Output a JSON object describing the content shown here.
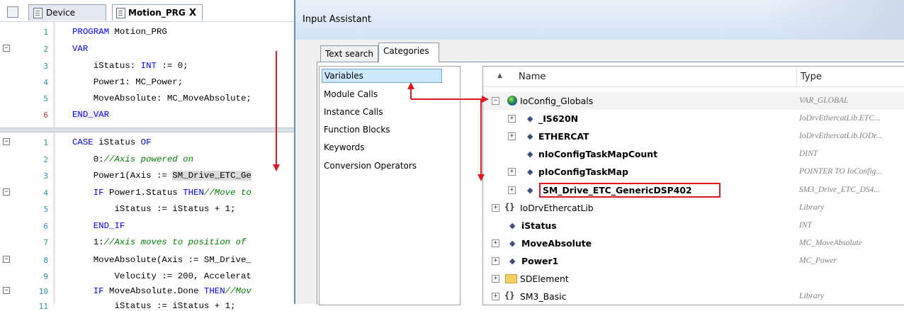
{
  "editor": {
    "tabs": [
      {
        "label": "Device"
      },
      {
        "label": "Motion_PRG",
        "close": "X"
      }
    ],
    "decl_lines": [
      {
        "num": "1",
        "text": "PROGRAM Motion_PRG"
      },
      {
        "num": "2",
        "text": "VAR"
      },
      {
        "num": "3",
        "text": "    iStatus: INT := 0;"
      },
      {
        "num": "4",
        "text": "    Power1: MC_Power;"
      },
      {
        "num": "5",
        "text": "    MoveAbsolute: MC_MoveAbsolute;"
      },
      {
        "num": "6",
        "text": "END_VAR"
      }
    ],
    "body_lines": [
      {
        "num": "1",
        "text": "CASE iStatus OF"
      },
      {
        "num": "2",
        "text": "    0://Axis powered on"
      },
      {
        "num": "3",
        "text": "    Power1(Axis := SM_Drive_ETC_Ge"
      },
      {
        "num": "4",
        "text": "    IF Power1.Status THEN//Move to"
      },
      {
        "num": "5",
        "text": "        iStatus := iStatus + 1;"
      },
      {
        "num": "6",
        "text": "    END_IF"
      },
      {
        "num": "7",
        "text": "    1://Axis moves to position of"
      },
      {
        "num": "8",
        "text": "    MoveAbsolute(Axis := SM_Drive_"
      },
      {
        "num": "9",
        "text": "        Velocity := 200, Accelerat"
      },
      {
        "num": "10",
        "text": "    IF MoveAbsolute.Done THEN//Mov"
      },
      {
        "num": "11",
        "text": "        iStatus := iStatus + 1;"
      }
    ]
  },
  "dialog": {
    "title": "Input Assistant",
    "tabs": {
      "text_search": "Text search",
      "categories": "Categories"
    },
    "categories": [
      "Variables",
      "Module Calls",
      "Instance Calls",
      "Function Blocks",
      "Keywords",
      "Conversion Operators"
    ],
    "columns": {
      "name": "Name",
      "type": "Type"
    },
    "rows": [
      {
        "name": "IoConfig_Globals",
        "type": "VAR_GLOBAL",
        "icon": "globe-icon",
        "expander": "−"
      },
      {
        "name": "_IS620N",
        "type": "IoDrvEthercatLib.ETC...",
        "icon": "variable-icon",
        "expander": "+"
      },
      {
        "name": "ETHERCAT",
        "type": "IoDrvEthercatLib.IODr...",
        "icon": "variable-icon",
        "expander": "+"
      },
      {
        "name": "nIoConfigTaskMapCount",
        "type": "DINT",
        "icon": "variable-icon",
        "expander": ""
      },
      {
        "name": "pIoConfigTaskMap",
        "type": "POINTER TO IoConfig...",
        "icon": "variable-icon",
        "expander": "+"
      },
      {
        "name": "SM_Drive_ETC_GenericDSP402",
        "type": "SM3_Drive_ETC_DS4...",
        "icon": "variable-icon",
        "expander": "+"
      },
      {
        "name": "IoDrvEthercatLib",
        "type": "Library",
        "icon": "library-icon",
        "expander": "+"
      },
      {
        "name": "iStatus",
        "type": "INT",
        "icon": "variable-icon",
        "expander": ""
      },
      {
        "name": "MoveAbsolute",
        "type": "MC_MoveAbsolute",
        "icon": "variable-icon",
        "expander": "+"
      },
      {
        "name": "Power1",
        "type": "MC_Power",
        "icon": "variable-icon",
        "expander": "+"
      },
      {
        "name": "SDElement",
        "type": "",
        "icon": "folder-icon",
        "expander": "+"
      },
      {
        "name": "SM3_Basic",
        "type": "Library",
        "icon": "library-icon",
        "expander": "+"
      }
    ]
  },
  "colors": {
    "annotation": "#e0181f",
    "selection": "#cce8ff",
    "keyword": "#0000ff",
    "comment": "#008000"
  }
}
